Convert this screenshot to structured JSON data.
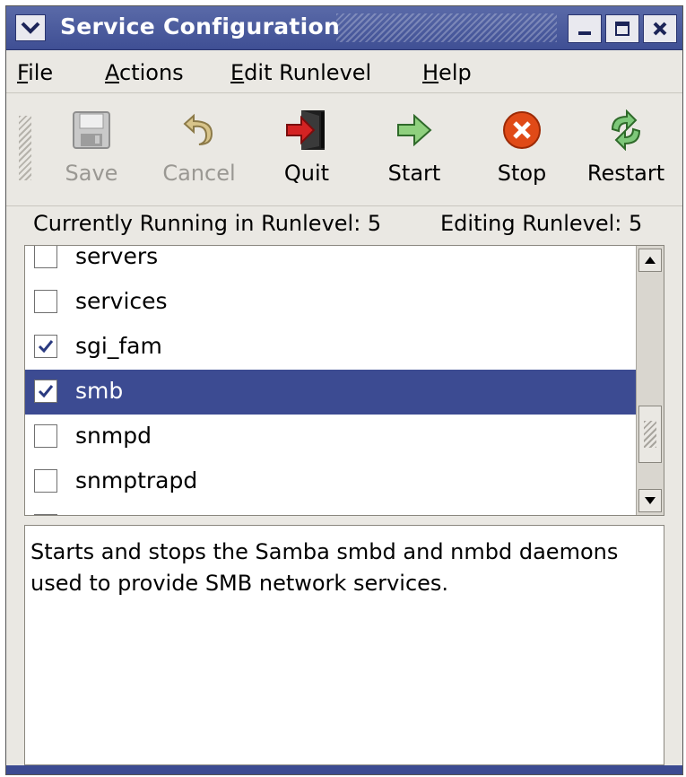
{
  "window": {
    "title": "Service Configuration"
  },
  "menu": {
    "items": [
      {
        "label": "File",
        "underline": "F",
        "rest": "ile"
      },
      {
        "label": "Actions",
        "underline": "A",
        "rest": "ctions"
      },
      {
        "label": "Edit Runlevel",
        "underline": "E",
        "rest": "dit Runlevel"
      },
      {
        "label": "Help",
        "underline": "H",
        "rest": "elp"
      }
    ]
  },
  "toolbar": {
    "save": {
      "label": "Save",
      "icon": "floppy-disk-icon",
      "enabled": false
    },
    "cancel": {
      "label": "Cancel",
      "icon": "undo-arrow-icon",
      "enabled": false
    },
    "quit": {
      "label": "Quit",
      "icon": "exit-door-icon",
      "enabled": true
    },
    "start": {
      "label": "Start",
      "icon": "green-arrow-icon",
      "enabled": true
    },
    "stop": {
      "label": "Stop",
      "icon": "red-stop-icon",
      "enabled": true
    },
    "restart": {
      "label": "Restart",
      "icon": "cycle-arrows-icon",
      "enabled": true
    }
  },
  "status": {
    "running": "Currently Running in Runlevel: 5",
    "editing": "Editing Runlevel: 5"
  },
  "services": [
    {
      "name": "servers",
      "checked": false,
      "selected": false
    },
    {
      "name": "services",
      "checked": false,
      "selected": false
    },
    {
      "name": "sgi_fam",
      "checked": true,
      "selected": false
    },
    {
      "name": "smb",
      "checked": true,
      "selected": true
    },
    {
      "name": "snmpd",
      "checked": false,
      "selected": false
    },
    {
      "name": "snmptrapd",
      "checked": false,
      "selected": false
    }
  ],
  "description": "Starts and stops the Samba smbd and nmbd daemons used to provide SMB network services.",
  "colors": {
    "selection": "#3c4b92",
    "titlebar": "#4a5a9e"
  }
}
